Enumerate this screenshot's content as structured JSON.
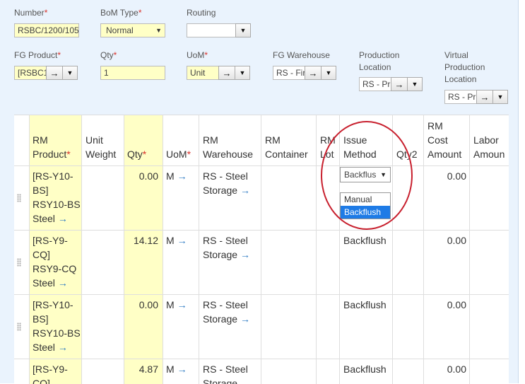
{
  "form": {
    "number": {
      "label": "Number",
      "value": "RSBC/1200/105"
    },
    "bom_type": {
      "label": "BoM Type",
      "value": "Normal"
    },
    "routing": {
      "label": "Routing",
      "value": ""
    },
    "fg_product": {
      "label": "FG Product",
      "value": "[RSBC1"
    },
    "qty": {
      "label": "Qty",
      "value": "1"
    },
    "uom": {
      "label": "UoM",
      "value": "Unit"
    },
    "fg_warehouse": {
      "label": "FG Warehouse",
      "value": "RS - Fir"
    },
    "production_location": {
      "label_line1": "Production",
      "label_line2": "Location",
      "value": "RS - Pr"
    },
    "virtual_production_location": {
      "label_line1": "Virtual",
      "label_line2": "Production",
      "label_line3": "Location",
      "value": "RS - Pr"
    },
    "required_mark": "*"
  },
  "grid": {
    "headers": {
      "rm_product_1": "RM",
      "rm_product_2": "Product",
      "unit_weight_1": "Unit",
      "unit_weight_2": "Weight",
      "qty": "Qty",
      "uom": "UoM",
      "rm_warehouse_1": "RM",
      "rm_warehouse_2": "Warehouse",
      "rm_container_1": "RM",
      "rm_container_2": "Container",
      "rm_lot_1": "RM",
      "rm_lot_2": "Lot",
      "issue_method_1": "Issue",
      "issue_method_2": "Method",
      "qty2": "Qty2",
      "rm_cost_1": "RM",
      "rm_cost_2": "Cost",
      "rm_cost_3": "Amount",
      "labor_1": "Labor",
      "labor_2": "Amoun"
    },
    "rows": [
      {
        "product_lines": [
          "[RS-Y10-",
          "BS]",
          "RSY10-BS",
          "Steel"
        ],
        "qty": "0.00",
        "uom": "M",
        "warehouse_lines": [
          "RS - Steel",
          "Storage"
        ],
        "issue_method": "Backflus",
        "rm_cost": "0.00"
      },
      {
        "product_lines": [
          "[RS-Y9-",
          "CQ]",
          "RSY9-CQ",
          "Steel"
        ],
        "qty": "14.12",
        "uom": "M",
        "warehouse_lines": [
          "RS - Steel",
          "Storage"
        ],
        "issue_method": "Backflush",
        "rm_cost": "0.00"
      },
      {
        "product_lines": [
          "[RS-Y10-",
          "BS]",
          "RSY10-BS",
          "Steel"
        ],
        "qty": "0.00",
        "uom": "M",
        "warehouse_lines": [
          "RS - Steel",
          "Storage"
        ],
        "issue_method": "Backflush",
        "rm_cost": "0.00"
      },
      {
        "product_lines": [
          "[RS-Y9-",
          "CQ]"
        ],
        "qty": "4.87",
        "uom": "M",
        "warehouse_lines": [
          "RS - Steel",
          "Storage"
        ],
        "issue_method": "Backflush",
        "rm_cost": "0.00"
      }
    ],
    "issue_method_dropdown": {
      "options": [
        "Manual",
        "Backflush"
      ],
      "selected": "Backflush"
    }
  },
  "icons": {
    "arrow": "→",
    "caret": "▼",
    "required": "*"
  }
}
